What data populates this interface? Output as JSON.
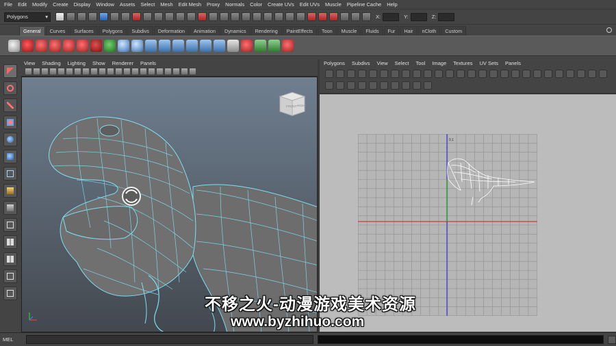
{
  "menubar": [
    "File",
    "Edit",
    "Modify",
    "Create",
    "Display",
    "Window",
    "Assets",
    "Select",
    "Mesh",
    "Edit Mesh",
    "Proxy",
    "Normals",
    "Color",
    "Create UVs",
    "Edit UVs",
    "Muscle",
    "Pipeline Cache",
    "Help"
  ],
  "status_line": {
    "mode": "Polygons",
    "coord_labels": [
      "X:",
      "Y:",
      "Z:"
    ]
  },
  "shelf": {
    "tabs": [
      "General",
      "Curves",
      "Surfaces",
      "Polygons",
      "Subdivs",
      "Deformation",
      "Animation",
      "Dynamics",
      "Rendering",
      "PaintEffects",
      "Toon",
      "Muscle",
      "Fluids",
      "Fur",
      "Hair",
      "nCloth",
      "Custom"
    ],
    "active_tab": "General"
  },
  "viewport": {
    "menu": [
      "View",
      "Shading",
      "Lighting",
      "Show",
      "Renderer",
      "Panels"
    ],
    "viewcube_labels": [
      "FRONT",
      "RIGHT"
    ]
  },
  "uv_editor": {
    "menu": [
      "Polygons",
      "Subdivs",
      "View",
      "Select",
      "Tool",
      "Image",
      "Textures",
      "UV Sets",
      "Panels"
    ],
    "axis_label": "0.1"
  },
  "command_line": {
    "label": "MEL"
  },
  "watermark": {
    "line1": "不移之火-动漫游戏美术资源",
    "line2": "www.byzhihuo.com"
  },
  "colors": {
    "ui_bg": "#444444",
    "shelf_bg": "#5a5a5a",
    "wireframe": "#7ee0f5",
    "uv_panel_bg": "#bcbcbc",
    "uv_grid_line": "#8f8f8f",
    "uv_axis_red": "#d03a3a",
    "uv_axis_blue": "#3a3ad0",
    "uv_axis_green": "#3aa03a"
  }
}
